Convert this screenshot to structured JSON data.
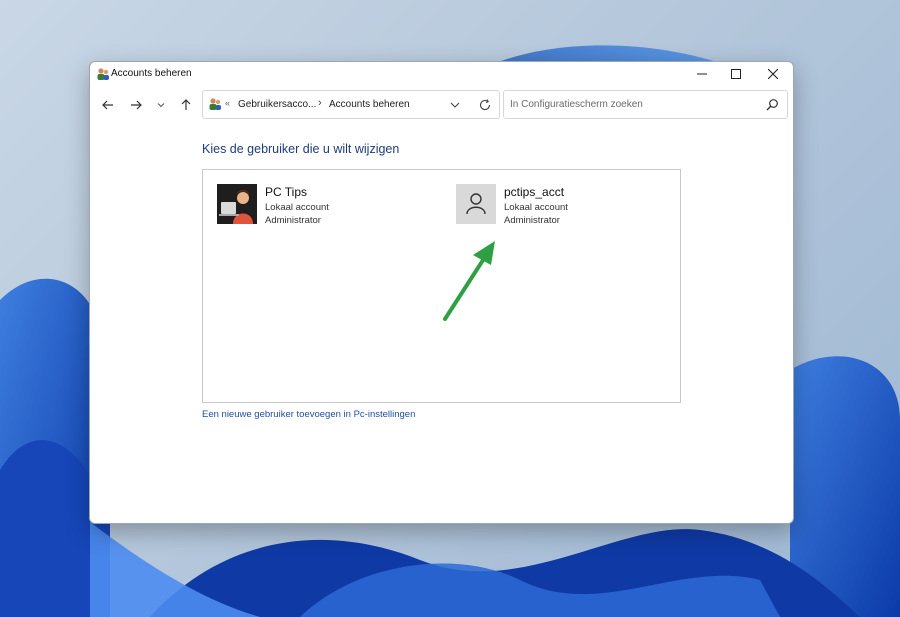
{
  "window": {
    "title": "Accounts beheren",
    "minimize_icon": "minimize-icon",
    "maximize_icon": "maximize-icon",
    "close_icon": "close-icon"
  },
  "navigation": {
    "breadcrumb": [
      "Gebruikersacco...",
      "Accounts beheren"
    ],
    "search_placeholder": "In Configuratiescherm zoeken"
  },
  "main": {
    "heading": "Kies de gebruiker die u wilt wijzigen",
    "accounts": [
      {
        "name": "PC Tips",
        "type": "Lokaal account",
        "role": "Administrator"
      },
      {
        "name": "pctips_acct",
        "type": "Lokaal account",
        "role": "Administrator"
      }
    ],
    "add_user_link": "Een nieuwe gebruiker toevoegen in Pc-instellingen"
  },
  "colors": {
    "heading": "#1e3d7b",
    "link": "#1f4e9e",
    "annotation_arrow": "#2ea043"
  }
}
